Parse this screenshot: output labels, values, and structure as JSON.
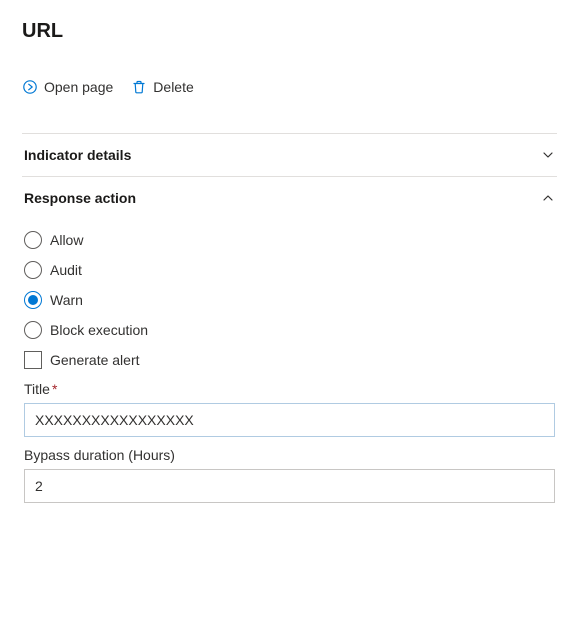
{
  "heading": "URL",
  "toolbar": {
    "open_page_label": "Open page",
    "delete_label": "Delete",
    "accent_color": "#0078d4"
  },
  "sections": {
    "indicator_details": {
      "title": "Indicator details",
      "expanded": false
    },
    "response_action": {
      "title": "Response action",
      "expanded": true,
      "options": {
        "allow": "Allow",
        "audit": "Audit",
        "warn": "Warn",
        "block": "Block execution"
      },
      "selected_option": "warn",
      "generate_alert": {
        "label": "Generate alert",
        "checked": false
      },
      "title_field": {
        "label": "Title",
        "required": true,
        "value": "XXXXXXXXXXXXXXXXX"
      },
      "bypass_field": {
        "label": "Bypass duration (Hours)",
        "value": "2"
      }
    }
  }
}
